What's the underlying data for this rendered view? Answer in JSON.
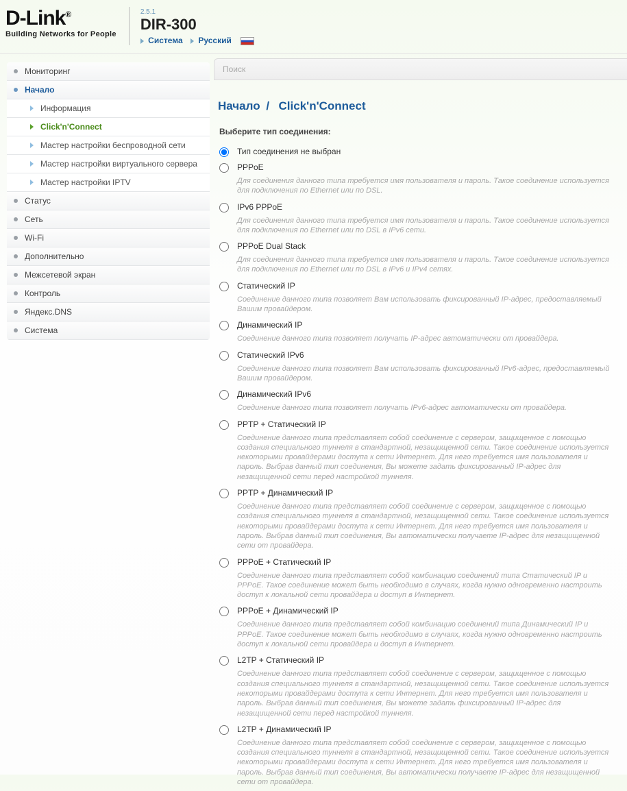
{
  "header": {
    "logo_text": "D-Link",
    "reg_mark": "®",
    "slogan": "Building Networks for People",
    "version": "2.5.1",
    "model": "DIR-300",
    "crumb_system": "Система",
    "crumb_lang": "Русский"
  },
  "search": {
    "placeholder": "Поиск"
  },
  "nav": {
    "items": [
      {
        "label": "Мониторинг",
        "type": "top"
      },
      {
        "label": "Начало",
        "type": "top",
        "active": true
      },
      {
        "label": "Информация",
        "type": "sub"
      },
      {
        "label": "Click'n'Connect",
        "type": "sub",
        "active": true
      },
      {
        "label": "Мастер настройки беспроводной сети",
        "type": "sub"
      },
      {
        "label": "Мастер настройки виртуального сервера",
        "type": "sub"
      },
      {
        "label": "Мастер настройки IPTV",
        "type": "sub"
      },
      {
        "label": "Статус",
        "type": "top"
      },
      {
        "label": "Сеть",
        "type": "top"
      },
      {
        "label": "Wi-Fi",
        "type": "top"
      },
      {
        "label": "Дополнительно",
        "type": "top"
      },
      {
        "label": "Межсетевой экран",
        "type": "top"
      },
      {
        "label": "Контроль",
        "type": "top"
      },
      {
        "label": "Яндекс.DNS",
        "type": "top"
      },
      {
        "label": "Система",
        "type": "top"
      }
    ]
  },
  "page": {
    "crumb_root": "Начало",
    "crumb_current": "Click'n'Connect",
    "subtitle": "Выберите тип соединения:"
  },
  "options": [
    {
      "label": "Тип соединения не выбран",
      "desc": "",
      "selected": true
    },
    {
      "label": "PPPoE",
      "desc": "Для соединения данного типа требуется имя пользователя и пароль. Такое соединение используется для подключения по Ethernet или по DSL."
    },
    {
      "label": "IPv6 PPPoE",
      "desc": "Для соединения данного типа требуется имя пользователя и пароль. Такое соединение используется для подключения по Ethernet или по DSL в IPv6 сети."
    },
    {
      "label": "PPPoE Dual Stack",
      "desc": "Для соединения данного типа требуется имя пользователя и пароль. Такое соединение используется для подключения по Ethernet или по DSL в IPv6 и IPv4 сетях."
    },
    {
      "label": "Статический IP",
      "desc": "Соединение данного типа позволяет Вам использовать фиксированный IP-адрес, предоставляемый Вашим провайдером."
    },
    {
      "label": "Динамический IP",
      "desc": "Соединение данного типа позволяет получать IP-адрес автоматически от провайдера."
    },
    {
      "label": "Статический IPv6",
      "desc": "Соединение данного типа позволяет Вам использовать фиксированный IPv6-адрес, предоставляемый Вашим провайдером."
    },
    {
      "label": "Динамический IPv6",
      "desc": "Соединение данного типа позволяет получать IPv6-адрес автоматически от провайдера."
    },
    {
      "label": "PPTP + Статический IP",
      "desc": "Соединение данного типа представляет собой соединение с сервером, защищенное с помощью создания специального туннеля в стандартной, незащищенной сети. Такое соединение используется некоторыми провайдерами доступа к сети Интернет. Для него требуется имя пользователя и пароль. Выбрав данный тип соединения, Вы можете задать фиксированный IP-адрес для незащищенной сети перед настройкой туннеля."
    },
    {
      "label": "PPTP + Динамический IP",
      "desc": "Соединение данного типа представляет собой соединение с сервером, защищенное с помощью создания специального туннеля в стандартной, незащищенной сети. Такое соединение используется некоторыми провайдерами доступа к сети Интернет. Для него требуется имя пользователя и пароль. Выбрав данный тип соединения, Вы автоматически получаете IP-адрес для незащищенной сети от провайдера."
    },
    {
      "label": "PPPoE + Статический IP",
      "desc": "Соединение данного типа представляет собой комбинацию соединений типа Статический IP и PPPoE. Такое соединение может быть необходимо в случаях, когда нужно одновременно настроить доступ к локальной сети провайдера и доступ в Интернет."
    },
    {
      "label": "PPPoE + Динамический IP",
      "desc": "Соединение данного типа представляет собой комбинацию соединений типа Динамический IP и PPPoE. Такое соединение может быть необходимо в случаях, когда нужно одновременно настроить доступ к локальной сети провайдера и доступ в Интернет."
    },
    {
      "label": "L2TP + Статический IP",
      "desc": "Соединение данного типа представляет собой соединение с сервером, защищенное с помощью создания специального туннеля в стандартной, незащищенной сети. Такое соединение используется некоторыми провайдерами доступа к сети Интернет. Для него требуется имя пользователя и пароль. Выбрав данный тип соединения, Вы можете задать фиксированный IP-адрес для незащищенной сети перед настройкой туннеля."
    },
    {
      "label": "L2TP + Динамический IP",
      "desc": "Соединение данного типа представляет собой соединение с сервером, защищенное с помощью создания специального туннеля в стандартной, незащищенной сети. Такое соединение используется некоторыми провайдерами доступа к сети Интернет. Для него требуется имя пользователя и пароль. Выбрав данный тип соединения, Вы автоматически получаете IP-адрес для незащищенной сети от провайдера."
    }
  ]
}
